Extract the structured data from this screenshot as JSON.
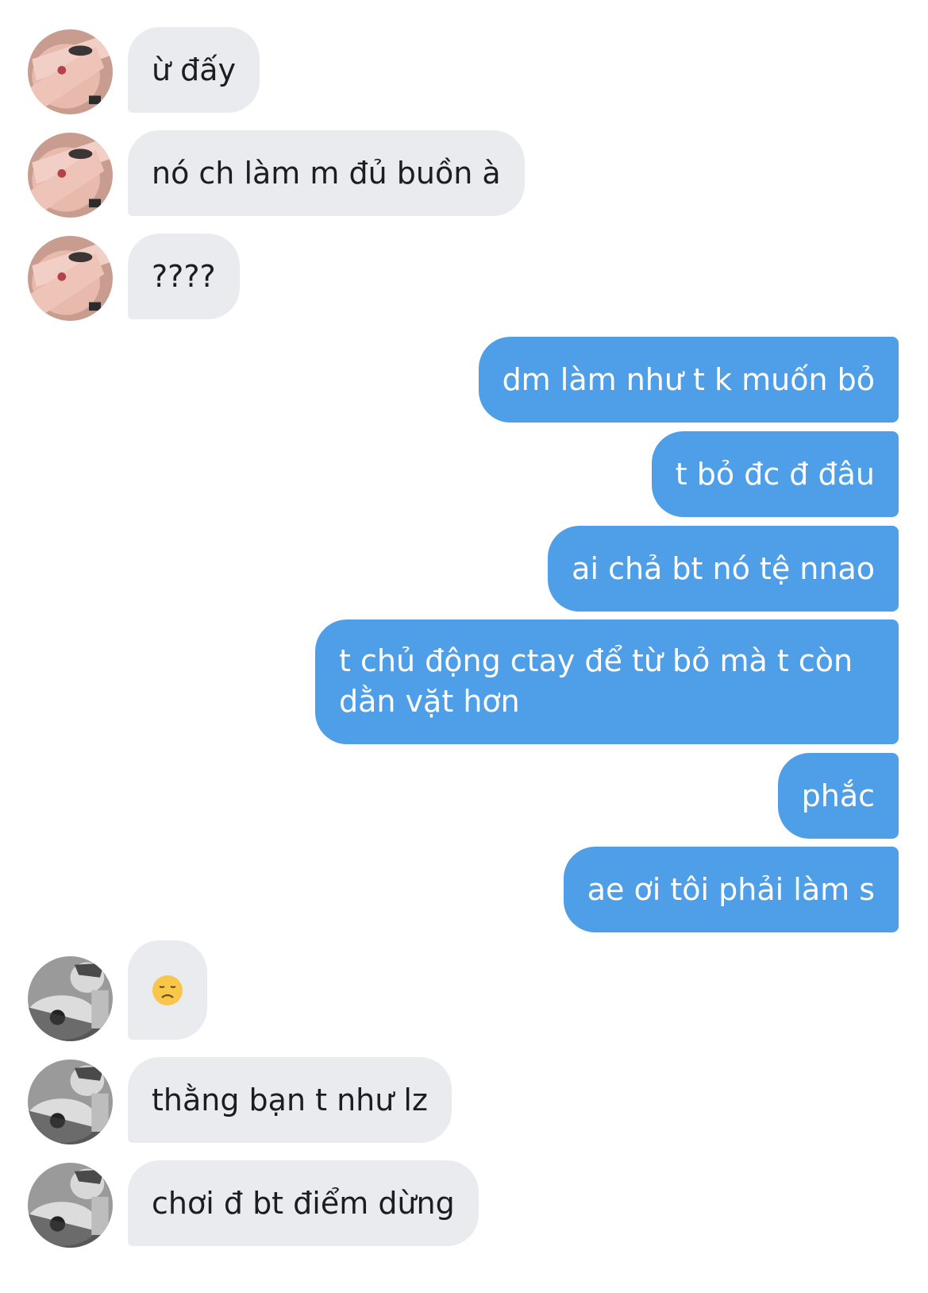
{
  "messages": [
    {
      "side": "in",
      "text": "ừ đấy",
      "avatar": "avatar-a"
    },
    {
      "side": "in",
      "text": "nó ch làm m đủ buồn à",
      "avatar": "avatar-a"
    },
    {
      "side": "in",
      "text": "????",
      "avatar": "avatar-a"
    },
    {
      "side": "out",
      "text": "dm làm như t k muốn bỏ"
    },
    {
      "side": "out",
      "text": "t bỏ đc đ đâu"
    },
    {
      "side": "out",
      "text": "ai chả bt nó tệ nnao"
    },
    {
      "side": "out",
      "text": "t chủ động ctay để từ bỏ mà t còn dằn vặt hơn"
    },
    {
      "side": "out",
      "text": "phắc"
    },
    {
      "side": "out",
      "text": "ae ơi tôi phải làm s"
    },
    {
      "side": "in",
      "emoji": "disappointed-face",
      "avatar": "avatar-b"
    },
    {
      "side": "in",
      "text": "thằng bạn t như lz",
      "avatar": "avatar-b"
    },
    {
      "side": "in",
      "text": "chơi đ bt điểm dừng",
      "avatar": "avatar-b"
    }
  ],
  "colors": {
    "incoming_bubble": "#e9ebef",
    "outgoing_bubble": "#4f9fe8",
    "background": "#ffffff"
  }
}
